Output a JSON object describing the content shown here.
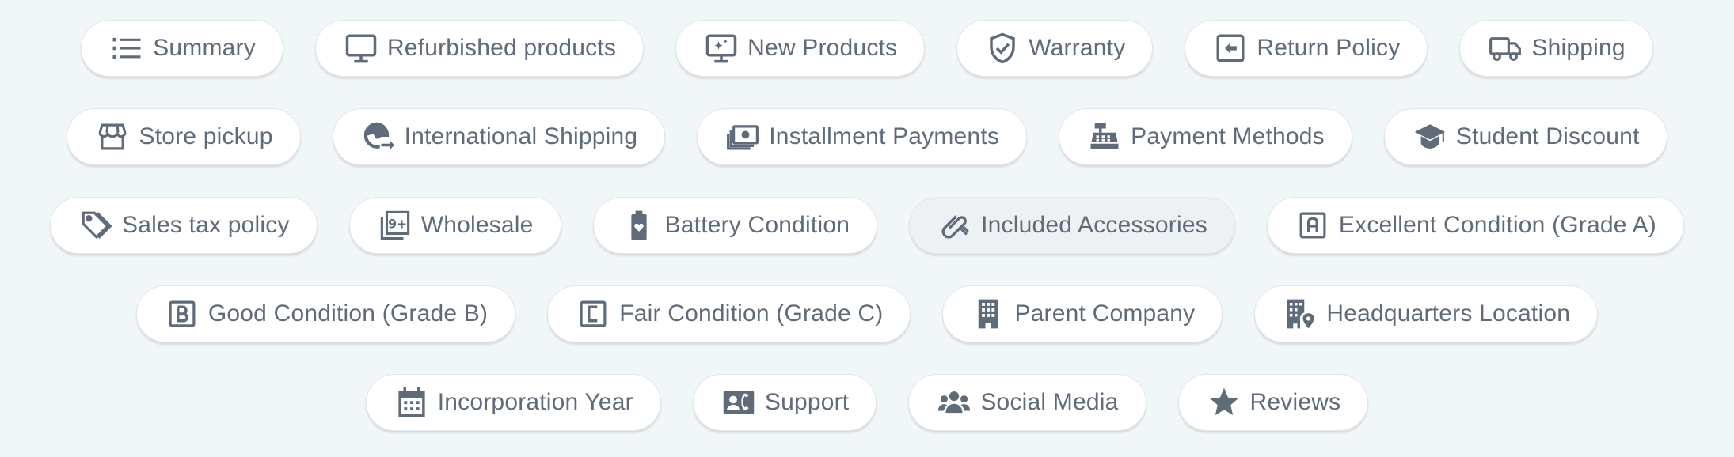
{
  "theme": {
    "background": "#f1f6f9",
    "chip_background": "#ffffff",
    "chip_active_background": "#eef1f3",
    "text_color": "#5f6b78",
    "icon_color": "#5f6b78"
  },
  "rows": [
    {
      "chips": [
        {
          "id": "summary",
          "label": "Summary",
          "icon": "list-icon"
        },
        {
          "id": "refurbished-products",
          "label": "Refurbished products",
          "icon": "monitor-icon"
        },
        {
          "id": "new-products",
          "label": "New Products",
          "icon": "monitor-sparkle-icon"
        },
        {
          "id": "warranty",
          "label": "Warranty",
          "icon": "shield-check-icon"
        },
        {
          "id": "return-policy",
          "label": "Return Policy",
          "icon": "return-arrow-icon"
        },
        {
          "id": "shipping",
          "label": "Shipping",
          "icon": "truck-icon"
        }
      ]
    },
    {
      "chips": [
        {
          "id": "store-pickup",
          "label": "Store pickup",
          "icon": "store-icon"
        },
        {
          "id": "international-shipping",
          "label": "International Shipping",
          "icon": "globe-arrow-icon"
        },
        {
          "id": "installment-payments",
          "label": "Installment Payments",
          "icon": "money-stack-icon"
        },
        {
          "id": "payment-methods",
          "label": "Payment Methods",
          "icon": "cash-register-icon"
        },
        {
          "id": "student-discount",
          "label": "Student Discount",
          "icon": "graduation-cap-icon"
        }
      ]
    },
    {
      "chips": [
        {
          "id": "sales-tax-policy",
          "label": "Sales tax policy",
          "icon": "tags-icon"
        },
        {
          "id": "wholesale",
          "label": "Wholesale",
          "icon": "nine-plus-icon"
        },
        {
          "id": "battery-condition",
          "label": "Battery Condition",
          "icon": "battery-heart-icon"
        },
        {
          "id": "included-accessories",
          "label": "Included Accessories",
          "icon": "paperclip-icon",
          "active": true
        },
        {
          "id": "excellent-condition",
          "label": "Excellent Condition (Grade A)",
          "icon": "grade-a-icon"
        }
      ]
    },
    {
      "chips": [
        {
          "id": "good-condition",
          "label": "Good Condition (Grade B)",
          "icon": "grade-b-icon"
        },
        {
          "id": "fair-condition",
          "label": "Fair Condition (Grade C)",
          "icon": "grade-c-icon"
        },
        {
          "id": "parent-company",
          "label": "Parent Company",
          "icon": "building-icon"
        },
        {
          "id": "headquarters-location",
          "label": "Headquarters Location",
          "icon": "building-pin-icon"
        }
      ]
    },
    {
      "chips": [
        {
          "id": "incorporation-year",
          "label": "Incorporation Year",
          "icon": "calendar-icon"
        },
        {
          "id": "support",
          "label": "Support",
          "icon": "contact-card-icon"
        },
        {
          "id": "social-media",
          "label": "Social Media",
          "icon": "users-icon"
        },
        {
          "id": "reviews",
          "label": "Reviews",
          "icon": "star-icon"
        }
      ]
    }
  ]
}
